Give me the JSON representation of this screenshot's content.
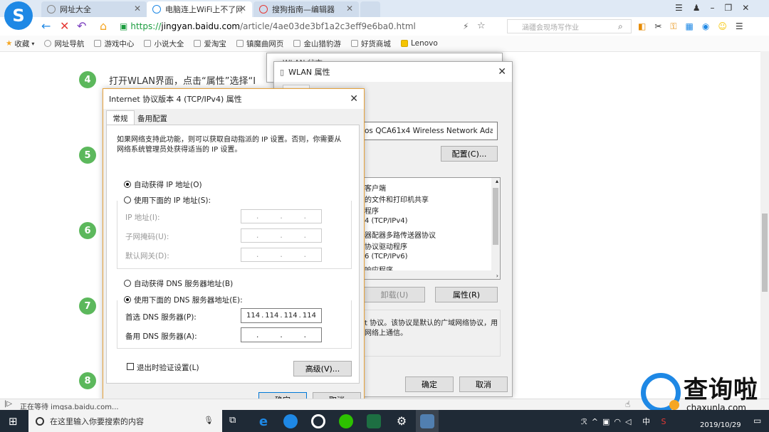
{
  "browser": {
    "tabs": [
      {
        "label": "网址大全"
      },
      {
        "label": "电脑连上WiFi上不了网怎"
      },
      {
        "label": "搜狗指南—编辑器"
      }
    ],
    "url_protocol": "https://",
    "url_host": "jingyan.baidu.com",
    "url_path": "/article/4ae03de3bf1a2c3eff9e6ba0.html",
    "search_placeholder": "涵疆会现场写作业",
    "bookmarks": [
      {
        "label": "收藏"
      },
      {
        "label": "网址导航"
      },
      {
        "label": "游戏中心"
      },
      {
        "label": "小说大全"
      },
      {
        "label": "爱淘宝"
      },
      {
        "label": "镇魔曲网页"
      },
      {
        "label": "金山猎豹游"
      },
      {
        "label": "好货商城"
      },
      {
        "label": "Lenovo"
      }
    ],
    "status_text": "正在等待 imgsa.baidu.com..."
  },
  "page": {
    "steps": [
      "4",
      "5",
      "6",
      "7",
      "8"
    ],
    "step4_text": "打开WLAN界面，点击“属性”选择“I"
  },
  "wlan_status_title": "WLAN 状态",
  "wlan": {
    "title": "WLAN 属性",
    "adapter": "os QCA61x4 Wireless Network Adapte",
    "configure": "配置(C)...",
    "items": [
      "客户端",
      "的文件和打印机共享",
      "程序",
      "4 (TCP/IPv4)",
      "器配器多路传送器协议",
      "协议驱动程序",
      "6 (TCP/IPv6)",
      "响应程序"
    ],
    "uninstall": "卸载(U)",
    "properties": "属性(R)",
    "description": "t 协议。该协议是默认的广域网络协议，用\n网络上通信。",
    "ok": "确定",
    "cancel": "取消"
  },
  "ipv4": {
    "title": "Internet 协议版本 4 (TCP/IPv4) 属性",
    "tab_general": "常规",
    "tab_alt": "备用配置",
    "intro": "如果网络支持此功能，则可以获取自动指派的 IP 设置。否则，你需要从网络系统管理员处获得适当的 IP 设置。",
    "auto_ip": "自动获得 IP 地址(O)",
    "manual_ip": "使用下面的 IP 地址(S):",
    "ip_label": "IP 地址(I):",
    "mask_label": "子网掩码(U):",
    "gateway_label": "默认网关(D):",
    "auto_dns": "自动获得 DNS 服务器地址(B)",
    "manual_dns": "使用下面的 DNS 服务器地址(E):",
    "pref_dns_label": "首选 DNS 服务器(P):",
    "pref_dns": [
      "114",
      "114",
      "114",
      "114"
    ],
    "alt_dns_label": "备用 DNS 服务器(A):",
    "validate": "退出时验证设置(L)",
    "advanced": "高级(V)...",
    "ok": "确定",
    "cancel": "取消",
    "selected_ip": "auto",
    "selected_dns": "manual"
  },
  "taskbar": {
    "search_placeholder": "在这里输入你要搜索的内容",
    "ime": "中",
    "date": "2019/10/29"
  },
  "watermark": {
    "text": "查询啦",
    "sub": "chaxunla.com"
  },
  "colors": {
    "accent": "#0078d7",
    "step_green": "#5cb85c",
    "url_green": "#1a9c3e"
  }
}
